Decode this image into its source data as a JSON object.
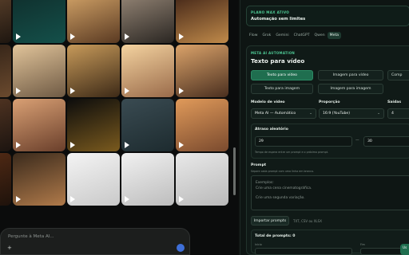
{
  "gallery": {
    "tiles": [
      {
        "g": "linear-gradient(160deg,#6a4b31,#1e1610)",
        "p": true
      },
      {
        "g": "linear-gradient(160deg,#0f2d2b,#14504a)",
        "p": true
      },
      {
        "g": "linear-gradient(160deg,#d8a86b,#5a3a22)",
        "p": true
      },
      {
        "g": "linear-gradient(160deg,#9a8a7a,#2a2622)",
        "p": true
      },
      {
        "g": "linear-gradient(160deg,#3b1f14,#c08a4a)",
        "p": true
      },
      {
        "g": "linear-gradient(160deg,#2a1d14,#6b4a2e)",
        "p": false
      },
      {
        "g": "linear-gradient(160deg,#e1c49a,#6f5a44)",
        "p": true
      },
      {
        "g": "linear-gradient(160deg,#c79a5a,#3d2a17)",
        "p": true
      },
      {
        "g": "linear-gradient(160deg,#f4d3a0,#9a6b4a)",
        "p": true
      },
      {
        "g": "linear-gradient(160deg,#dba36a,#4a2f1f)",
        "p": true
      },
      {
        "g": "linear-gradient(160deg,#5a3a25,#1c1410)",
        "p": true
      },
      {
        "g": "linear-gradient(160deg,#d9a074,#6a3f2b)",
        "p": true
      },
      {
        "g": "linear-gradient(160deg,#0c0c0c,#7a5a1e)",
        "p": true
      },
      {
        "g": "linear-gradient(160deg,#3a4b52,#1d2b2f)",
        "p": true
      },
      {
        "g": "linear-gradient(160deg,#e09a5a,#7a4a2e)",
        "p": true
      },
      {
        "g": "linear-gradient(160deg,#5a2e16,#1e120b)",
        "p": true
      },
      {
        "g": "linear-gradient(160deg,#3a2a1c,#b07a4a)",
        "p": true
      },
      {
        "g": "linear-gradient(160deg,#f4f4f4,#c9c9c9)",
        "p": true
      },
      {
        "g": "linear-gradient(160deg,#f1f1f1,#bdbdbd)",
        "p": true
      },
      {
        "g": "linear-gradient(160deg,#e9e9e9,#b9b9b9)",
        "p": true
      }
    ]
  },
  "ask": {
    "placeholder": "Pergunte à Meta AI..."
  },
  "plan": {
    "label": "PLANO MAX ATIVO",
    "text": "Automação sem limites"
  },
  "tabs": [
    {
      "label": "Flow",
      "active": false
    },
    {
      "label": "Grok",
      "active": false
    },
    {
      "label": "Gemini",
      "active": false
    },
    {
      "label": "ChatGPT",
      "active": false
    },
    {
      "label": "Qwen",
      "active": false
    },
    {
      "label": "Meta",
      "active": true
    }
  ],
  "card": {
    "section": "META AI AUTOMATION",
    "title": "Texto para vídeo",
    "modes": {
      "m1": "Texto para vídeo",
      "m2": "Imagem para vídeo",
      "m3": "Comp",
      "m4": "Texto para imagem",
      "m5": "Imagem para imagem"
    },
    "fields": {
      "model_label": "Modelo de vídeo",
      "model_value": "Meta AI — Automático",
      "ratio_label": "Proporção",
      "ratio_value": "16:9 (YouTube)",
      "outputs_label": "Saídas",
      "outputs_value": "4"
    },
    "delay": {
      "label": "Atraso aleatório",
      "min": "29",
      "sep": "—",
      "max": "30",
      "hint": "Tempo de espera entre um prompt e o próximo prompt."
    },
    "prompt": {
      "label": "Prompt",
      "hint": "Separe cada prompt com uma linha em branco.",
      "example": "Exemplos:",
      "line1": "Crie uma cena cinematográfica.",
      "line2": "Crie uma segunda variação."
    },
    "import_label": "Importar prompts",
    "formats": "TXT, CSV ou XLSX",
    "total": {
      "label": "Total de prompts: 0",
      "start": "Início",
      "end": "Fim"
    }
  },
  "fab": "Us"
}
